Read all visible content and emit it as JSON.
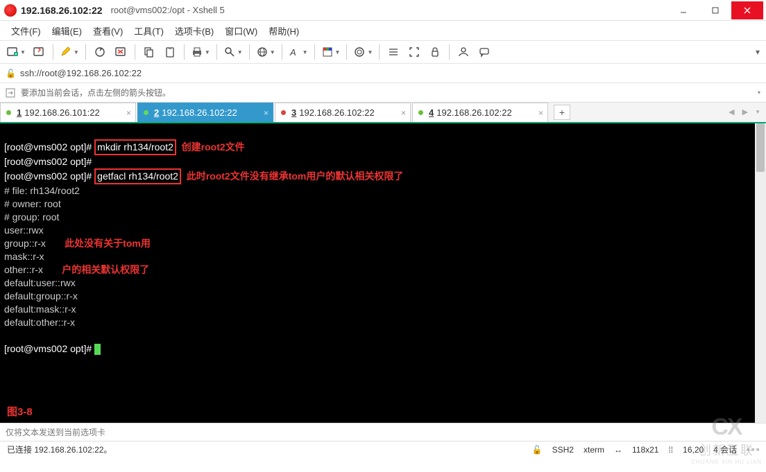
{
  "title": {
    "ip": "192.168.26.102:22",
    "suffix": "root@vms002:/opt - Xshell 5"
  },
  "menus": [
    "文件(F)",
    "编辑(E)",
    "查看(V)",
    "工具(T)",
    "选项卡(B)",
    "窗口(W)",
    "帮助(H)"
  ],
  "address": {
    "url": "ssh://root@192.168.26.102:22"
  },
  "hint": "要添加当前会话，点击左侧的箭头按钮。",
  "tabs": [
    {
      "num": "1",
      "label": "192.168.26.101:22",
      "active": false
    },
    {
      "num": "2",
      "label": "192.168.26.102:22",
      "active": true
    },
    {
      "num": "3",
      "label": "192.168.26.102:22",
      "active": false
    },
    {
      "num": "4",
      "label": "192.168.26.102:22",
      "active": false
    }
  ],
  "terminal": {
    "prompt1": "[root@vms002 opt]#",
    "cmd1": "mkdir rh134/root2",
    "anno1": "创建root2文件",
    "prompt2": "[root@vms002 opt]#",
    "prompt3": "[root@vms002 opt]#",
    "cmd2": "getfacl rh134/root2",
    "anno2": "此时root2文件没有继承tom用户的默认相关权限了",
    "out1": "# file: rh134/root2",
    "out2": "# owner: root",
    "out3": "# group: root",
    "out4": "user::rwx",
    "out5": "group::r-x",
    "out6": "mask::r-x",
    "out7": "other::r-x",
    "out8": "default:user::rwx",
    "out9": "default:group::r-x",
    "out10": "default:mask::r-x",
    "out11": "default:other::r-x",
    "prompt4": "[root@vms002 opt]#",
    "anno3a": "此处没有关于tom用",
    "anno3b": "户的相关默认权限了",
    "figure": "图3-8"
  },
  "sendbar": "仅将文本发送到当前选项卡",
  "status": {
    "conn": "已连接 192.168.26.102:22。",
    "proto": "SSH2",
    "term": "xterm",
    "size": "118x21",
    "pos": "16,20",
    "sess": "4 会话"
  },
  "watermark": {
    "logo": "CX",
    "cn": "创新互联",
    "py": "CHUANG XIN HU LIAN"
  }
}
